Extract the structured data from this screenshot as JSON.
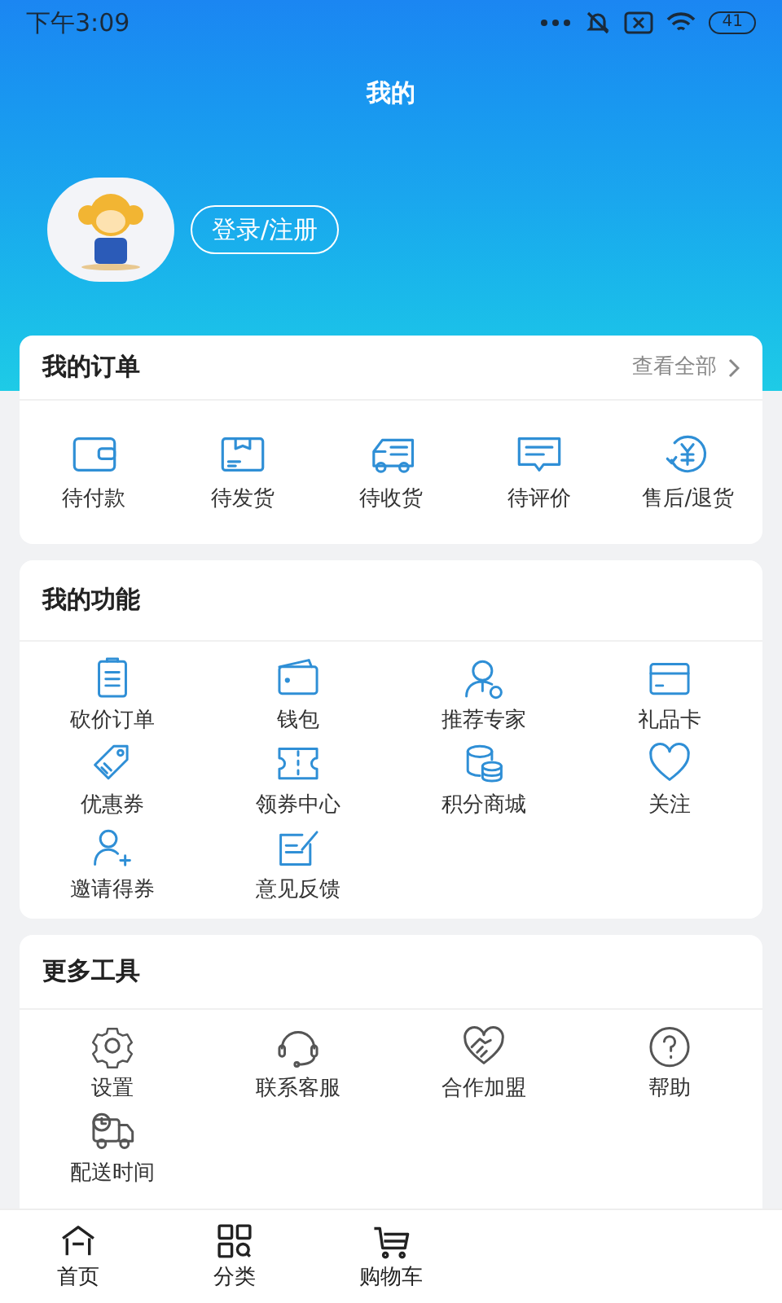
{
  "status_bar": {
    "time": "下午3:09",
    "battery": "41"
  },
  "header": {
    "title": "我的",
    "login_button": "登录/注册"
  },
  "orders": {
    "title": "我的订单",
    "view_all": "查看全部",
    "items": [
      "待付款",
      "待发货",
      "待收货",
      "待评价",
      "售后/退货"
    ]
  },
  "functions": {
    "title": "我的功能",
    "items": [
      "砍价订单",
      "钱包",
      "推荐专家",
      "礼品卡",
      "优惠券",
      "领券中心",
      "积分商城",
      "关注",
      "邀请得券",
      "意见反馈"
    ]
  },
  "tools": {
    "title": "更多工具",
    "items": [
      "设置",
      "联系客服",
      "合作加盟",
      "帮助",
      "配送时间"
    ]
  },
  "tab_bar": [
    {
      "label": "首页",
      "selected": false
    },
    {
      "label": "分类",
      "selected": false
    },
    {
      "label": "购物车",
      "selected": false
    }
  ]
}
